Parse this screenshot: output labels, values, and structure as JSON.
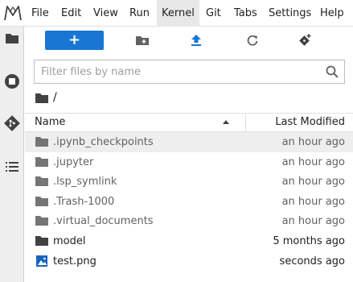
{
  "menu": {
    "items": [
      {
        "label": "File"
      },
      {
        "label": "Edit"
      },
      {
        "label": "View"
      },
      {
        "label": "Run"
      },
      {
        "label": "Kernel"
      },
      {
        "label": "Git"
      },
      {
        "label": "Tabs"
      },
      {
        "label": "Settings"
      },
      {
        "label": "Help"
      }
    ],
    "active": "Kernel"
  },
  "activitybar": {
    "icons": [
      "folder-icon",
      "running-icon",
      "git-icon",
      "toc-icon"
    ],
    "active": "folder-icon"
  },
  "toolbar": {
    "new_label": "+",
    "icons": [
      "new-folder-icon",
      "upload-icon",
      "refresh-icon",
      "git-clone-icon"
    ]
  },
  "filter": {
    "placeholder": "Filter files by name",
    "value": ""
  },
  "breadcrumb": {
    "path": "/"
  },
  "list": {
    "header_name": "Name",
    "header_modified": "Last Modified",
    "sort": "ascending",
    "rows": [
      {
        "name": ".ipynb_checkpoints",
        "modified": "an hour ago",
        "type": "folder",
        "hidden": true
      },
      {
        "name": ".jupyter",
        "modified": "an hour ago",
        "type": "folder",
        "hidden": true
      },
      {
        "name": ".lsp_symlink",
        "modified": "an hour ago",
        "type": "folder",
        "hidden": true
      },
      {
        "name": ".Trash-1000",
        "modified": "an hour ago",
        "type": "folder",
        "hidden": true
      },
      {
        "name": ".virtual_documents",
        "modified": "an hour ago",
        "type": "folder",
        "hidden": true
      },
      {
        "name": "model",
        "modified": "5 months ago",
        "type": "folder",
        "hidden": false
      },
      {
        "name": "test.png",
        "modified": "seconds ago",
        "type": "image",
        "hidden": false
      }
    ]
  },
  "colors": {
    "accent": "#1976d2",
    "icon_gray": "#616161",
    "icon_dark": "#424242"
  }
}
